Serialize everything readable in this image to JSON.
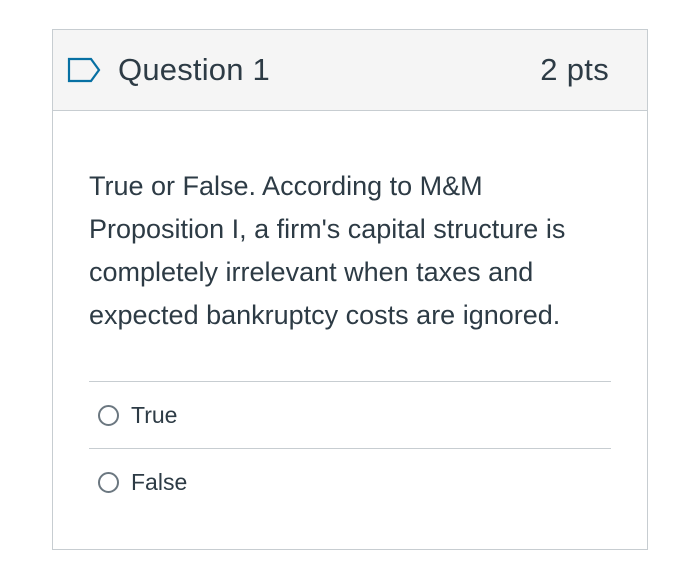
{
  "question": {
    "title": "Question 1",
    "points": "2 pts",
    "flag_icon": "flag-outline-icon",
    "text": "True or False. According to M&M Proposition I, a firm's capital structure is completely irrelevant when taxes and expected bankruptcy costs are ignored.",
    "answers": [
      {
        "label": "True",
        "selected": false
      },
      {
        "label": "False",
        "selected": false
      }
    ]
  },
  "colors": {
    "header_bg": "#f5f5f5",
    "border": "#c7cdd1",
    "text": "#2d3b45",
    "flag": "#0770a3"
  }
}
